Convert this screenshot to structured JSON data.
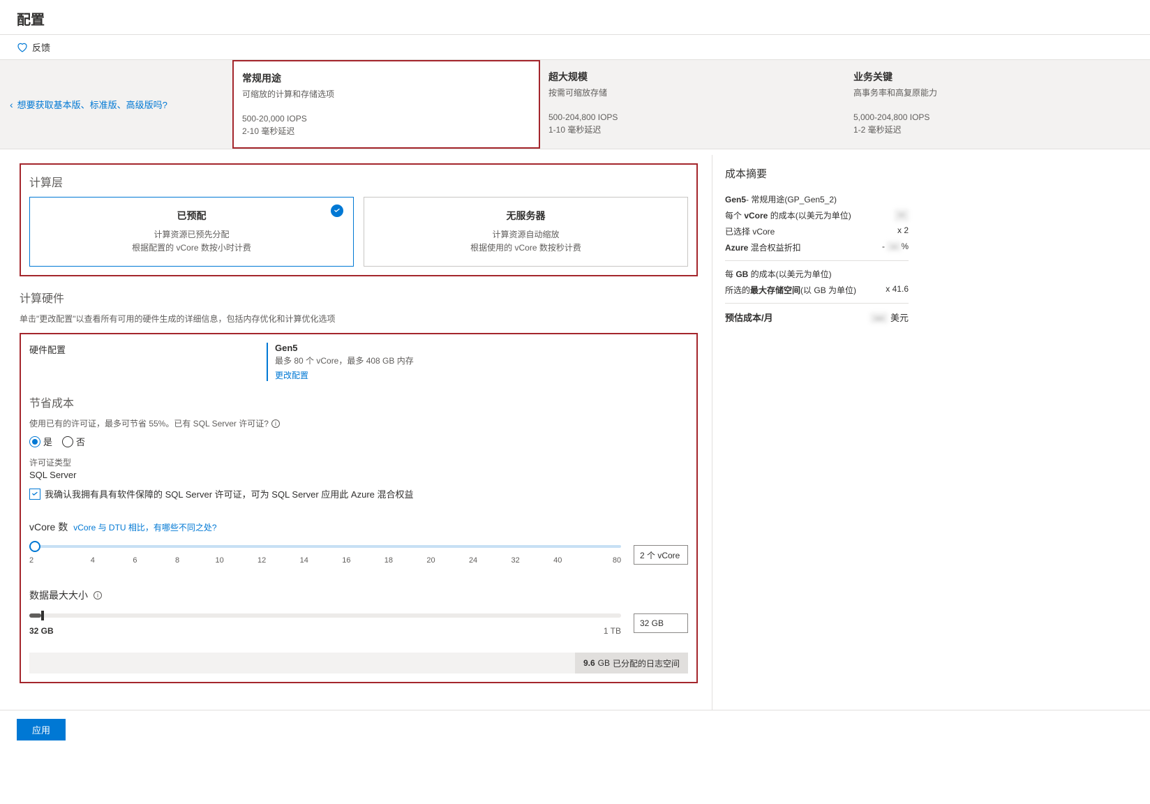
{
  "header": {
    "title": "配置"
  },
  "feedback": {
    "label": "反馈"
  },
  "tier_back": {
    "label": "想要获取基本版、标准版、高级版吗?"
  },
  "tiers": [
    {
      "title": "常规用途",
      "sub": "可缩放的计算和存储选项",
      "spec1": "500-20,000 IOPS",
      "spec2": "2-10 毫秒延迟"
    },
    {
      "title": "超大规模",
      "sub": "按需可缩放存储",
      "spec1": "500-204,800 IOPS",
      "spec2": "1-10 毫秒延迟"
    },
    {
      "title": "业务关键",
      "sub": "高事务率和高复原能力",
      "spec1": "5,000-204,800 IOPS",
      "spec2": "1-2 毫秒延迟"
    }
  ],
  "compute_layer": {
    "title": "计算层",
    "cards": [
      {
        "title": "已预配",
        "line1": "计算资源已预先分配",
        "line2": "根据配置的 vCore 数按小时计费"
      },
      {
        "title": "无服务器",
        "line1": "计算资源自动缩放",
        "line2": "根据使用的 vCore 数按秒计费"
      }
    ]
  },
  "hardware": {
    "title": "计算硬件",
    "desc": "单击\"更改配置\"以查看所有可用的硬件生成的详细信息，包括内存优化和计算优化选项",
    "label": "硬件配置",
    "name": "Gen5",
    "spec": "最多 80 个 vCore，最多 408 GB 内存",
    "link": "更改配置"
  },
  "savings": {
    "title": "节省成本",
    "question": "使用已有的许可证，最多可节省 55%。已有 SQL Server 许可证?",
    "yes": "是",
    "no": "否",
    "lic_type_label": "许可证类型",
    "lic_type_value": "SQL Server",
    "confirm": "我确认我拥有具有软件保障的 SQL Server 许可证，可为 SQL Server 应用此 Azure 混合权益"
  },
  "vcore": {
    "title": "vCore 数",
    "link": "vCore 与 DTU 相比，有哪些不同之处?",
    "ticks": [
      "2",
      "4",
      "6",
      "8",
      "10",
      "12",
      "14",
      "16",
      "18",
      "20",
      "24",
      "32",
      "40",
      "80"
    ],
    "value": "2 个 vCore"
  },
  "datasize": {
    "title": "数据最大大小",
    "min": "32 GB",
    "max": "1 TB",
    "value": "32 GB"
  },
  "logspace": {
    "num": "9.6",
    "unit": "GB",
    "label": "已分配的日志空间"
  },
  "summary": {
    "title": "成本摘要",
    "row1_l": "Gen5",
    "row1_r": "- 常规用途(GP_Gen5_2)",
    "row2_l": "每个 vCore 的成本(以美元为单位)",
    "row3_l": "已选择 vCore",
    "row3_r": "x 2",
    "row4_l": "Azure 混合权益折扣",
    "row4_r_suffix": "%",
    "row5_l": "每 GB 的成本(以美元为单位)",
    "row6_l": "所选的最大存储空间(以 GB 为单位)",
    "row6_r": "x 41.6",
    "total_l": "预估成本/月",
    "total_unit": "美元"
  },
  "footer": {
    "apply": "应用"
  }
}
